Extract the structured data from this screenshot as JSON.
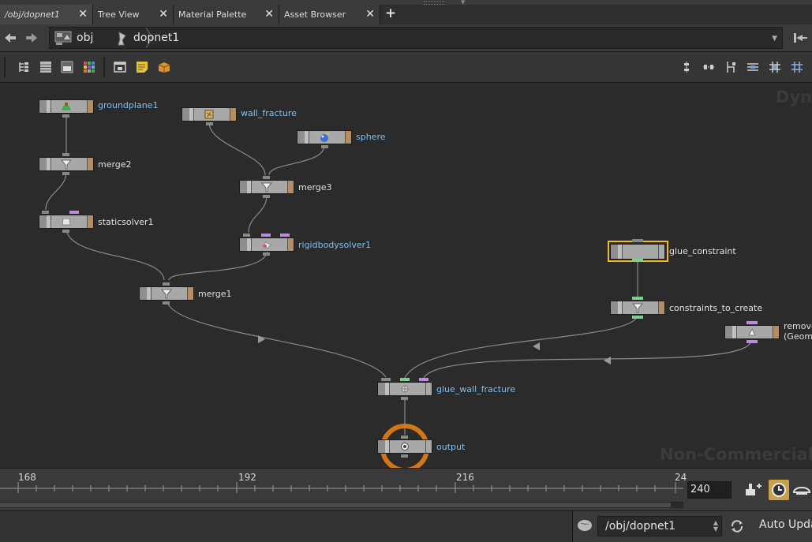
{
  "tabs": [
    {
      "label": "/obj/dopnet1",
      "close": "✕"
    },
    {
      "label": "Tree View",
      "close": "✕"
    },
    {
      "label": "Material Palette",
      "close": "✕"
    },
    {
      "label": "Asset Browser",
      "close": "✕"
    }
  ],
  "tab_add": "+",
  "path": {
    "crumbs": [
      "obj",
      "dopnet1"
    ]
  },
  "watermarks": {
    "top": "Dyn",
    "bottom": "Non-Commercial E"
  },
  "nodes": {
    "groundplane1": "groundplane1",
    "wall_fracture": "wall_fracture",
    "sphere": "sphere",
    "merge2": "merge2",
    "merge3": "merge3",
    "staticsolver1": "staticsolver1",
    "rigidbodysolver1": "rigidbodysolver1",
    "merge1": "merge1",
    "glue_constraint": "glue_constraint",
    "constraints_to_create": "constraints_to_create",
    "remove_line1": "remove",
    "remove_line2": "(Geom",
    "glue_wall_fracture": "glue_wall_fracture",
    "output": "output"
  },
  "timeline": {
    "ticks": [
      "168",
      "192",
      "216",
      "24"
    ],
    "end_frame": "240"
  },
  "status": {
    "path": "/obj/dopnet1",
    "auto_update": "Auto Upda"
  }
}
